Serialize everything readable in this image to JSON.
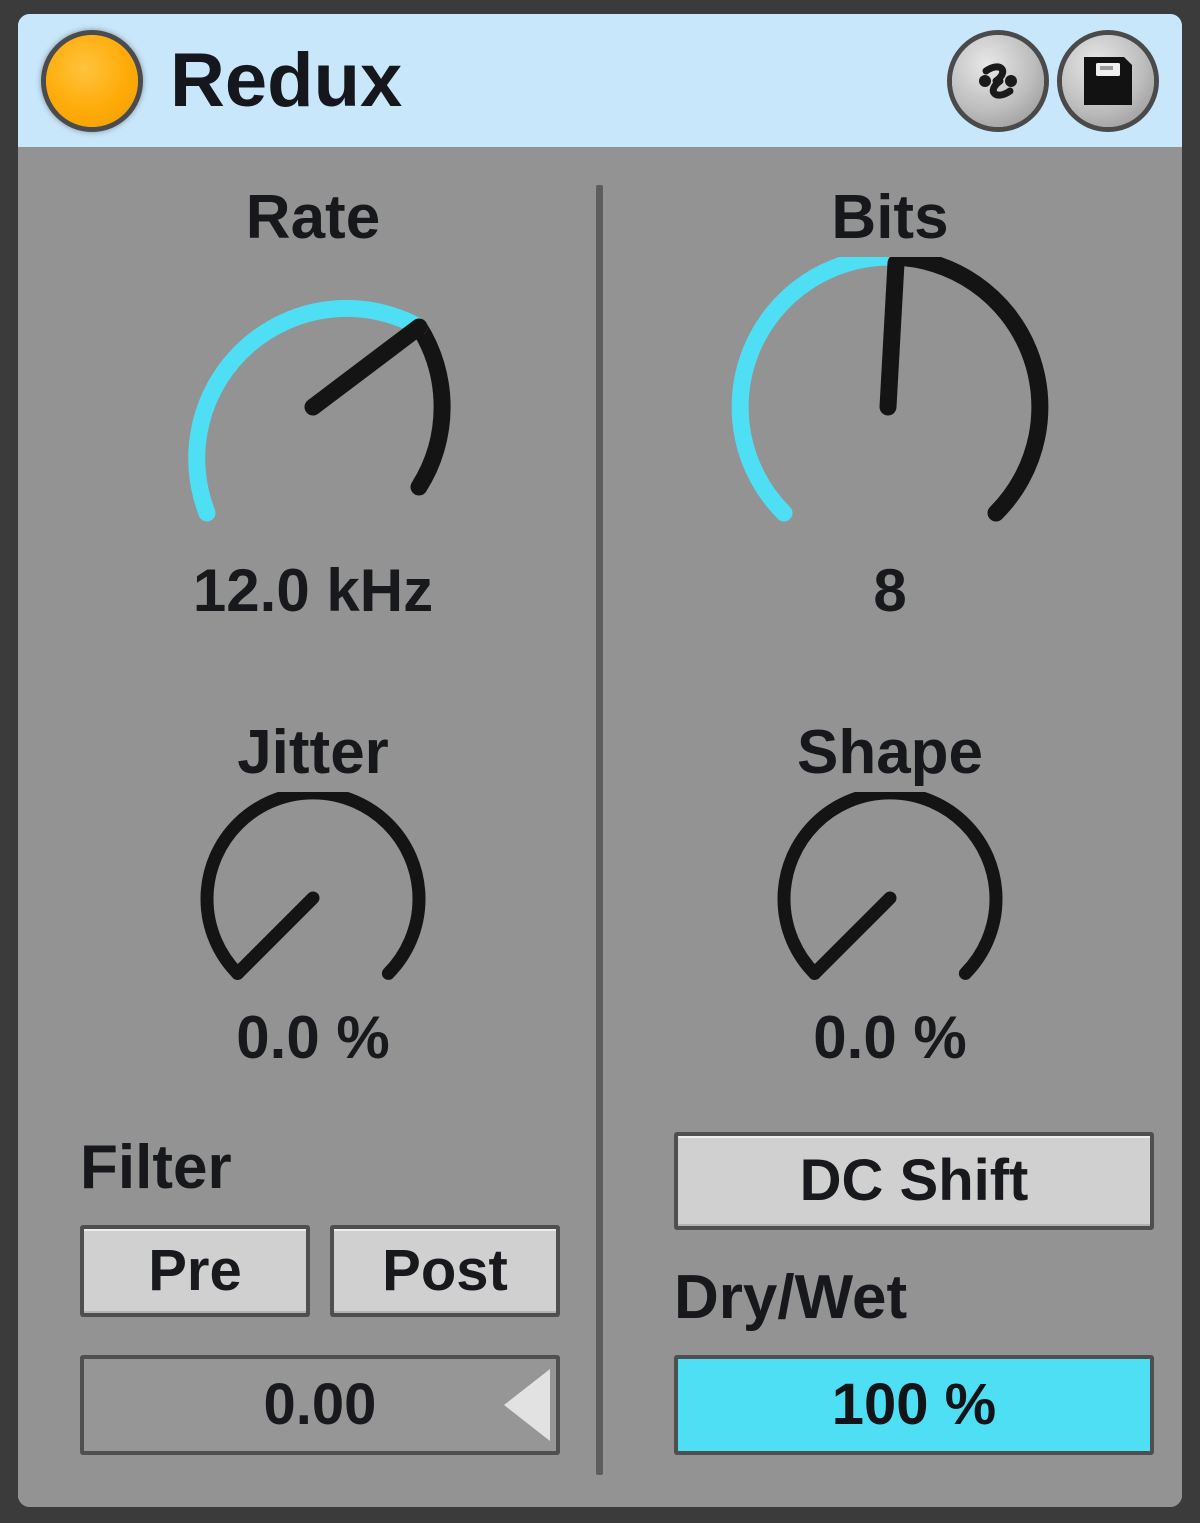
{
  "device": {
    "title": "Redux",
    "activation_led": {
      "name": "device-on-led",
      "state": "on",
      "color": "#FFAC0A"
    },
    "title_bar_color": "#C9E7FB",
    "body_color": "#939393",
    "accent_color": "#4FDFF5",
    "title_buttons": [
      {
        "name": "hot-swap-icon",
        "label": "Hot-Swap Presets"
      },
      {
        "name": "save-preset-icon",
        "label": "Save Preset"
      }
    ]
  },
  "left_column": {
    "rate": {
      "label": "Rate",
      "value": "12.0 kHz",
      "arc_value_deg": 180,
      "pointer_deg": 135
    },
    "jitter": {
      "label": "Jitter",
      "value": "0.0 %",
      "arc_value_deg": 0,
      "pointer_deg": -135
    },
    "filter": {
      "label": "Filter",
      "pre_label": "Pre",
      "post_label": "Post",
      "pre_active": false,
      "post_active": false,
      "amount_value": "0.00"
    }
  },
  "right_column": {
    "bits": {
      "label": "Bits",
      "value": "8",
      "arc_value_deg": 128,
      "pointer_deg": 83
    },
    "shape": {
      "label": "Shape",
      "value": "0.0 %",
      "arc_value_deg": 0,
      "pointer_deg": -135
    },
    "dc_shift": {
      "label": "DC Shift",
      "active": false
    },
    "dry_wet": {
      "label": "Dry/Wet",
      "value": "100 %",
      "fill_percent": 100
    }
  }
}
